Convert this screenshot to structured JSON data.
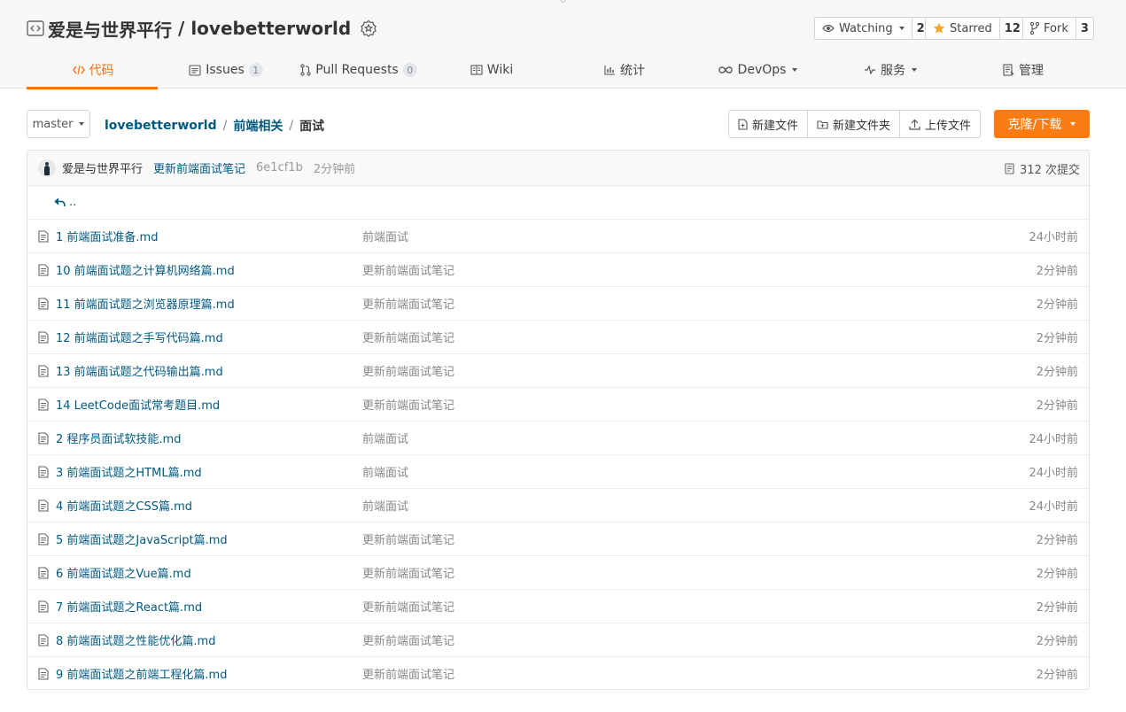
{
  "repo": {
    "owner": "爱是与世界平行",
    "separator": "/",
    "name": "lovebetterworld"
  },
  "actions": {
    "watch_label": "Watching",
    "watch_count": "2",
    "star_label": "Starred",
    "star_count": "12",
    "fork_label": "Fork",
    "fork_count": "3"
  },
  "tabs": [
    {
      "label": "代码"
    },
    {
      "label": "Issues",
      "count": "1"
    },
    {
      "label": "Pull Requests",
      "count": "0"
    },
    {
      "label": "Wiki"
    },
    {
      "label": "统计"
    },
    {
      "label": "DevOps"
    },
    {
      "label": "服务"
    },
    {
      "label": "管理"
    }
  ],
  "branch": {
    "name": "master"
  },
  "breadcrumb": {
    "items": [
      "lovebetterworld",
      "前端相关",
      "面试"
    ],
    "separator": "/"
  },
  "file_ops": {
    "new_file": "新建文件",
    "new_folder": "新建文件夹",
    "upload": "上传文件",
    "clone": "克隆/下载"
  },
  "commit": {
    "author": "爱是与世界平行",
    "message": "更新前端面试笔记",
    "hash": "6e1cf1b",
    "time": "2分钟前",
    "total": "312 次提交"
  },
  "parent_dir": "..",
  "files": [
    {
      "name": "1 前端面试准备.md",
      "commit": "前端面试",
      "time": "24小时前"
    },
    {
      "name": "10 前端面试题之计算机网络篇.md",
      "commit": "更新前端面试笔记",
      "time": "2分钟前"
    },
    {
      "name": "11 前端面试题之浏览器原理篇.md",
      "commit": "更新前端面试笔记",
      "time": "2分钟前"
    },
    {
      "name": "12 前端面试题之手写代码篇.md",
      "commit": "更新前端面试笔记",
      "time": "2分钟前"
    },
    {
      "name": "13 前端面试题之代码输出篇.md",
      "commit": "更新前端面试笔记",
      "time": "2分钟前"
    },
    {
      "name": "14 LeetCode面试常考题目.md",
      "commit": "更新前端面试笔记",
      "time": "2分钟前"
    },
    {
      "name": "2 程序员面试软技能.md",
      "commit": "前端面试",
      "time": "24小时前"
    },
    {
      "name": "3 前端面试题之HTML篇.md",
      "commit": "前端面试",
      "time": "24小时前"
    },
    {
      "name": "4 前端面试题之CSS篇.md",
      "commit": "前端面试",
      "time": "24小时前"
    },
    {
      "name": "5 前端面试题之JavaScript篇.md",
      "commit": "更新前端面试笔记",
      "time": "2分钟前"
    },
    {
      "name": "6 前端面试题之Vue篇.md",
      "commit": "更新前端面试笔记",
      "time": "2分钟前"
    },
    {
      "name": "7 前端面试题之React篇.md",
      "commit": "更新前端面试笔记",
      "time": "2分钟前"
    },
    {
      "name": "8 前端面试题之性能优化篇.md",
      "commit": "更新前端面试笔记",
      "time": "2分钟前"
    },
    {
      "name": "9 前端面试题之前端工程化篇.md",
      "commit": "更新前端面试笔记",
      "time": "2分钟前"
    }
  ],
  "colors": {
    "accent": "#f27212",
    "clone_button": "#fa7c13",
    "link": "#005980"
  }
}
